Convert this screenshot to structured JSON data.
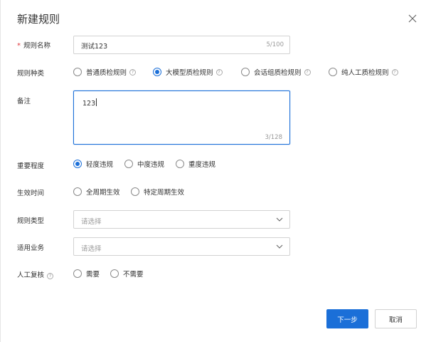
{
  "dialog": {
    "title": "新建规则",
    "close_icon": "close-icon"
  },
  "form": {
    "rule_name": {
      "label": "规则名称",
      "required_mark": "*",
      "value": "测试123",
      "count": "5/100"
    },
    "rule_kind": {
      "label": "规则种类",
      "options": [
        "普通质检规则",
        "大模型质检规则",
        "会话组质检规则",
        "纯人工质检规则"
      ],
      "selected": "大模型质检规则"
    },
    "remark": {
      "label": "备注",
      "value": "123",
      "count": "3/128"
    },
    "importance": {
      "label": "重要程度",
      "options": [
        "轻度违规",
        "中度违规",
        "重度违规"
      ],
      "selected": "轻度违规"
    },
    "effective_time": {
      "label": "生效时间",
      "options": [
        "全周期生效",
        "特定周期生效"
      ],
      "selected": null
    },
    "rule_type": {
      "label": "规则类型",
      "placeholder": "请选择"
    },
    "business": {
      "label": "适用业务",
      "placeholder": "请选择"
    },
    "manual_review": {
      "label": "人工复核",
      "options": [
        "需要",
        "不需要"
      ],
      "selected": null
    }
  },
  "footer": {
    "next_label": "下一步",
    "cancel_label": "取消"
  },
  "colors": {
    "primary": "#1b6fd8",
    "required": "#e0393e"
  }
}
